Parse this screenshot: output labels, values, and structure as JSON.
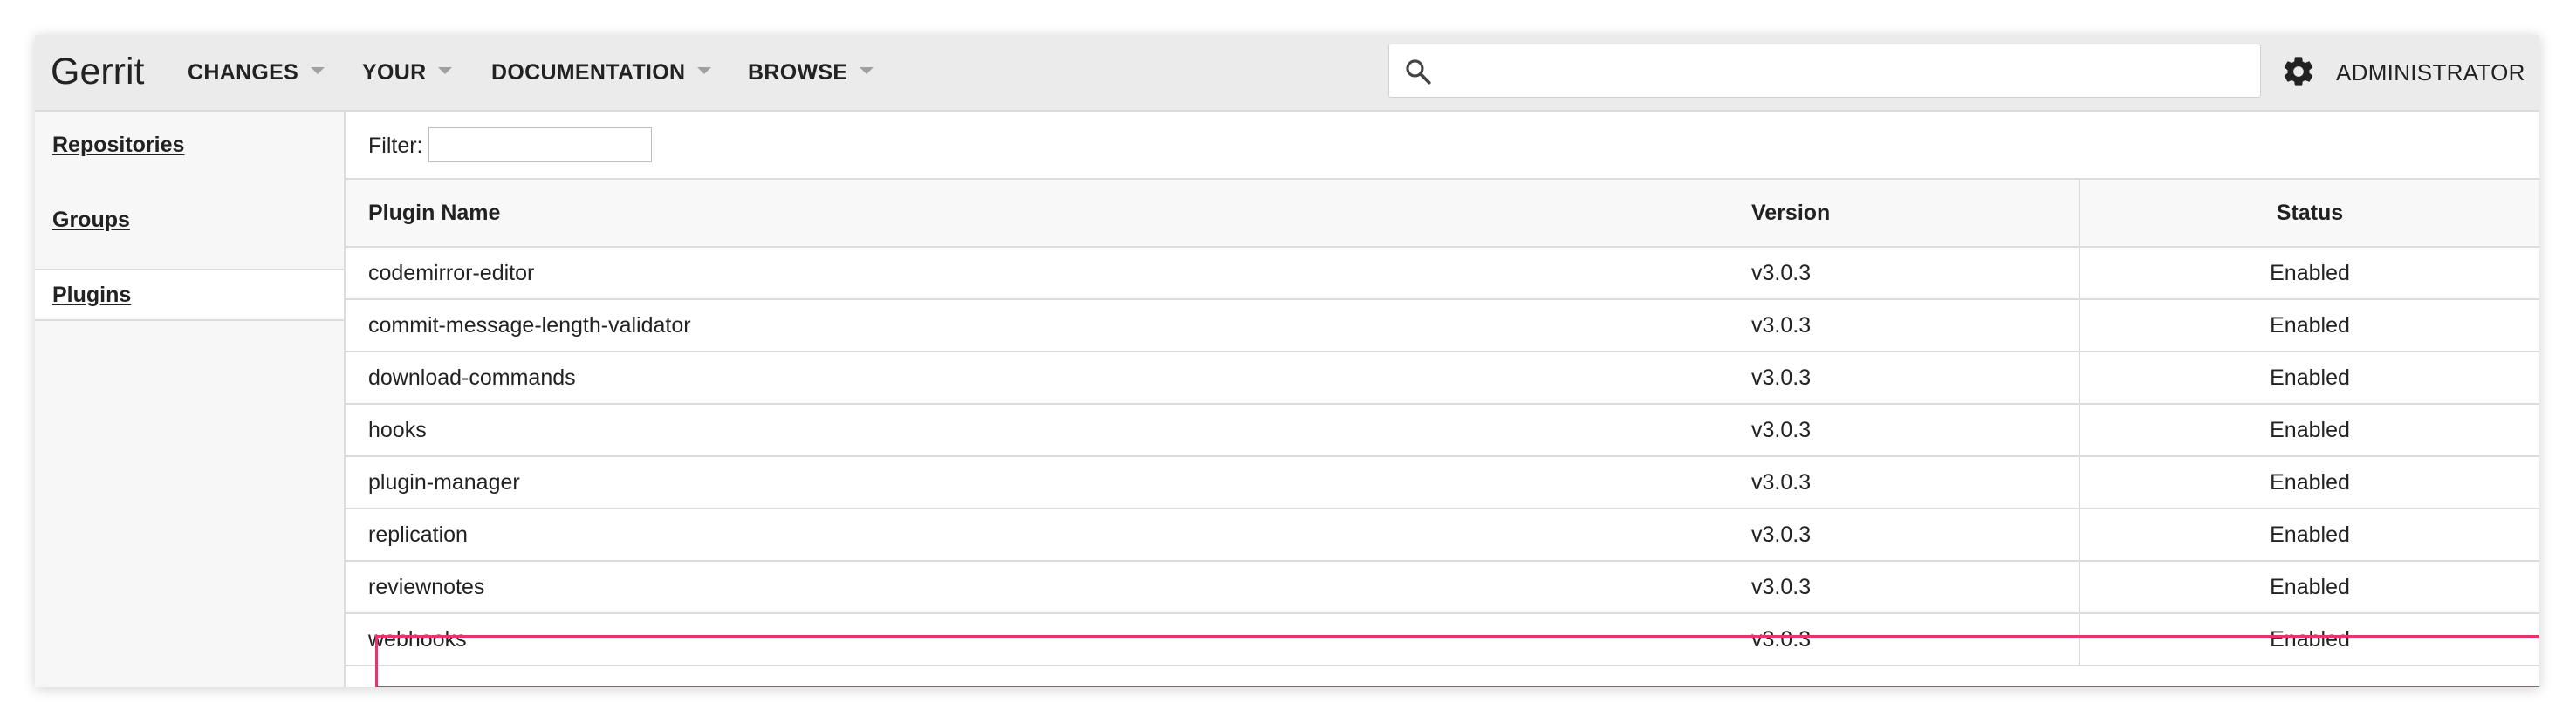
{
  "header": {
    "brand": "Gerrit",
    "nav": [
      {
        "label": "CHANGES"
      },
      {
        "label": "YOUR"
      },
      {
        "label": "DOCUMENTATION"
      },
      {
        "label": "BROWSE"
      }
    ],
    "search": {
      "placeholder": "",
      "value": "",
      "icon": "search-icon"
    },
    "settings_icon": "gear-icon",
    "account": "ADMINISTRATOR"
  },
  "sidebar": {
    "items": [
      {
        "label": "Repositories",
        "active": false
      },
      {
        "label": "Groups",
        "active": false
      },
      {
        "label": "Plugins",
        "active": true
      }
    ]
  },
  "filter": {
    "label": "Filter:",
    "value": ""
  },
  "table": {
    "columns": [
      "Plugin Name",
      "Version",
      "Status"
    ],
    "rows": [
      {
        "name": "codemirror-editor",
        "version": "v3.0.3",
        "status": "Enabled"
      },
      {
        "name": "commit-message-length-validator",
        "version": "v3.0.3",
        "status": "Enabled"
      },
      {
        "name": "download-commands",
        "version": "v3.0.3",
        "status": "Enabled"
      },
      {
        "name": "hooks",
        "version": "v3.0.3",
        "status": "Enabled"
      },
      {
        "name": "plugin-manager",
        "version": "v3.0.3",
        "status": "Enabled"
      },
      {
        "name": "replication",
        "version": "v3.0.3",
        "status": "Enabled"
      },
      {
        "name": "reviewnotes",
        "version": "v3.0.3",
        "status": "Enabled"
      },
      {
        "name": "webhooks",
        "version": "v3.0.3",
        "status": "Enabled",
        "highlighted": true
      }
    ]
  },
  "colors": {
    "highlight": "#e8336d",
    "header_bg": "#ebebeb",
    "sidebar_bg": "#f7f7f7"
  }
}
